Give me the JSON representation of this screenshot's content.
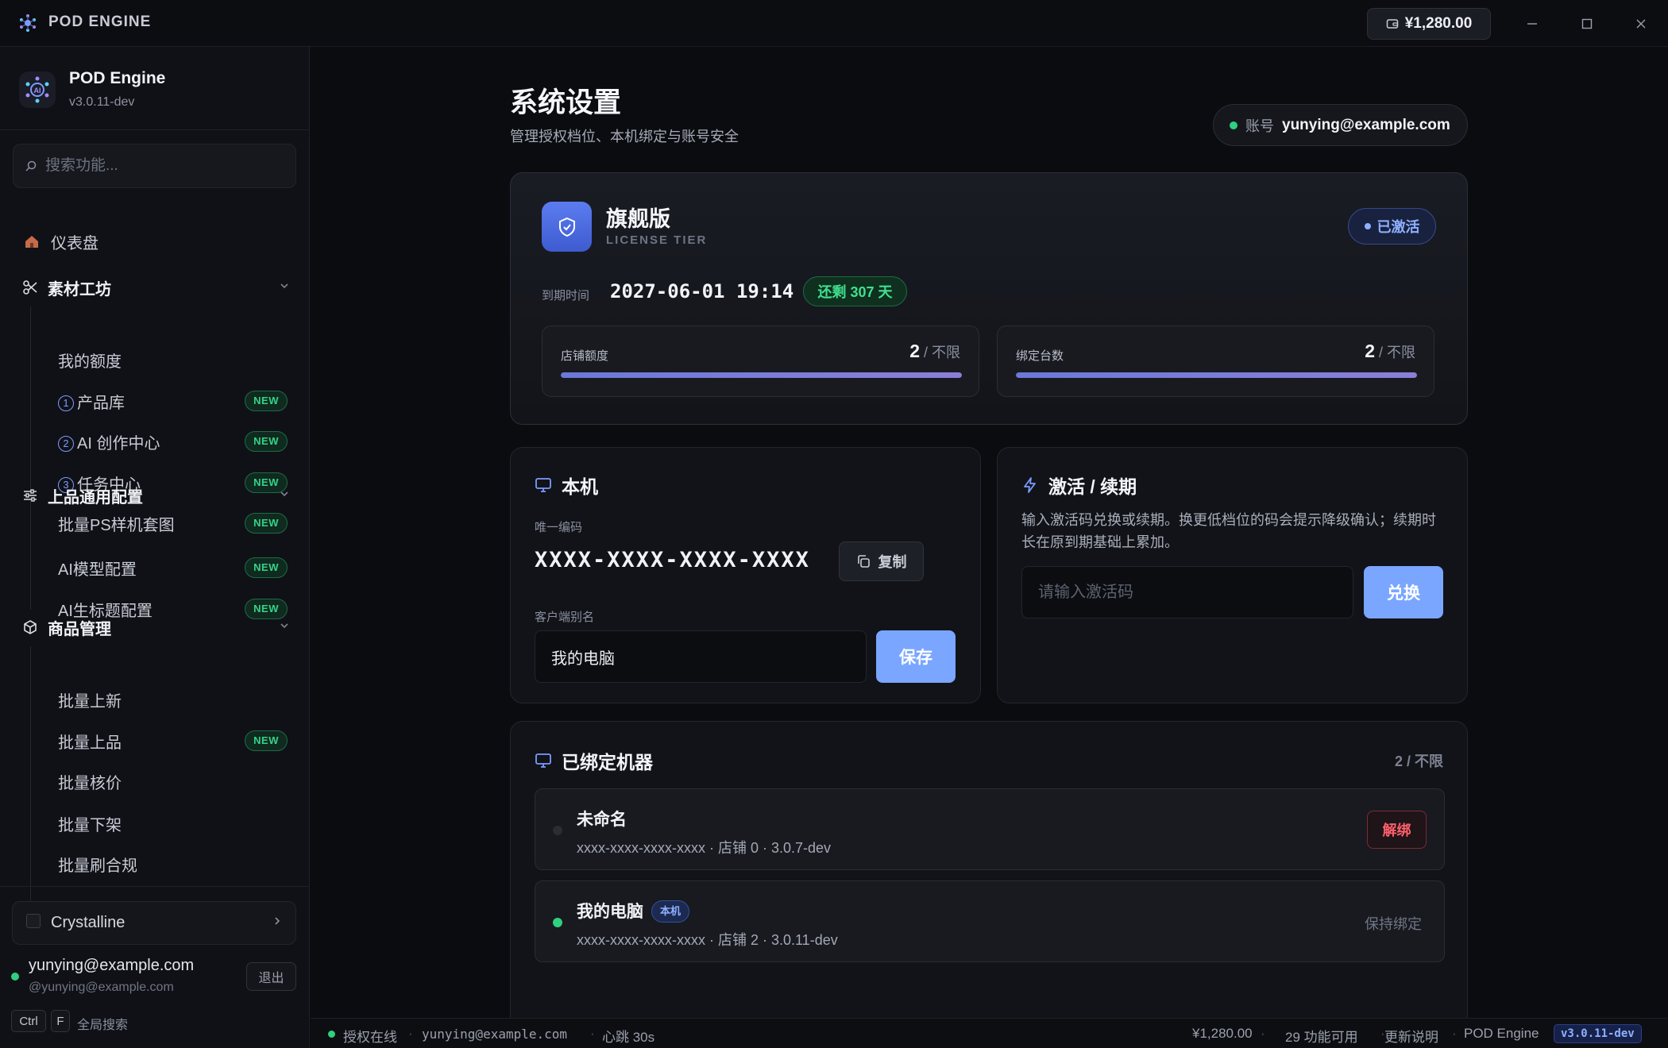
{
  "titlebar": {
    "app_title": "POD ENGINE",
    "balance": "¥1,280.00"
  },
  "sidebar": {
    "brand_name": "POD Engine",
    "brand_version": "v3.0.11-dev",
    "search_placeholder": "搜索功能...",
    "dashboard": "仪表盘",
    "groups": [
      {
        "label": "素材工坊",
        "icon": "scissors-icon",
        "items": [
          {
            "label": "我的额度",
            "num": "",
            "badge": ""
          },
          {
            "label": "产品库",
            "num": "1",
            "badge": "NEW"
          },
          {
            "label": "AI 创作中心",
            "num": "2",
            "badge": "NEW"
          },
          {
            "label": "任务中心",
            "num": "3",
            "badge": "NEW"
          },
          {
            "label": "批量PS样机套图",
            "num": "",
            "badge": "NEW"
          }
        ]
      },
      {
        "label": "上品通用配置",
        "icon": "sliders-icon",
        "items": [
          {
            "label": "AI模型配置",
            "num": "",
            "badge": "NEW"
          },
          {
            "label": "AI生标题配置",
            "num": "",
            "badge": "NEW"
          }
        ]
      },
      {
        "label": "商品管理",
        "icon": "box-icon",
        "items": [
          {
            "label": "批量上新",
            "num": "",
            "badge": ""
          },
          {
            "label": "批量上品",
            "num": "",
            "badge": "NEW"
          },
          {
            "label": "批量核价",
            "num": "",
            "badge": ""
          },
          {
            "label": "批量下架",
            "num": "",
            "badge": ""
          },
          {
            "label": "批量刷合规",
            "num": "",
            "badge": ""
          }
        ]
      }
    ],
    "theme": "Crystalline",
    "user_email": "yunying@example.com",
    "user_handle": "@yunying@example.com",
    "logout": "退出",
    "kbd_ctrl": "Ctrl",
    "kbd_f": "F",
    "kbd_hint": "全局搜索"
  },
  "header": {
    "title": "系统设置",
    "subtitle": "管理授权档位、本机绑定与账号安全",
    "account_label": "账号",
    "account_value": "yunying@example.com"
  },
  "license": {
    "tier_name": "旗舰版",
    "tier_sub": "LICENSE TIER",
    "status": "已激活",
    "expire_label": "到期时间",
    "expire_value": "2027-06-01 19:14",
    "remaining": "还剩 307 天",
    "quotas": [
      {
        "label": "店铺额度",
        "used": "2",
        "limit": " / 不限",
        "fill": 1.0
      },
      {
        "label": "绑定台数",
        "used": "2",
        "limit": " / 不限",
        "fill": 1.0
      }
    ]
  },
  "machine": {
    "title": "本机",
    "code_label": "唯一编码",
    "code": "XXXX-XXXX-XXXX-XXXX",
    "copy": "复制",
    "alias_label": "客户端别名",
    "alias_value": "我的电脑",
    "save": "保存"
  },
  "activate": {
    "title": "激活 / 续期",
    "desc": "输入激活码兑换或续期。换更低档位的码会提示降级确认；续期时长在原到期基础上累加。",
    "placeholder": "请输入激活码",
    "redeem": "兑换"
  },
  "bound": {
    "title": "已绑定机器",
    "count": "2 / 不限",
    "rows": [
      {
        "name": "未命名",
        "meta": "xxxx-xxxx-xxxx-xxxx · 店铺 0 · 3.0.7-dev",
        "tag": "",
        "action": "解绑",
        "online": false
      },
      {
        "name": "我的电脑",
        "meta": "xxxx-xxxx-xxxx-xxxx · 店铺 2 · 3.0.11-dev",
        "tag": "本机",
        "action": "保持绑定",
        "online": true
      }
    ]
  },
  "statusbar": {
    "auth": "授权在线",
    "email": "yunying@example.com",
    "heartbeat": "心跳 30s",
    "balance": "¥1,280.00",
    "features": "29 功能可用",
    "changelog": "更新说明",
    "app": "POD Engine",
    "version": "v3.0.11-dev"
  },
  "colors": {
    "accent": "#7aa6ff",
    "success": "#2fd07f",
    "danger": "#ff5f6d"
  }
}
